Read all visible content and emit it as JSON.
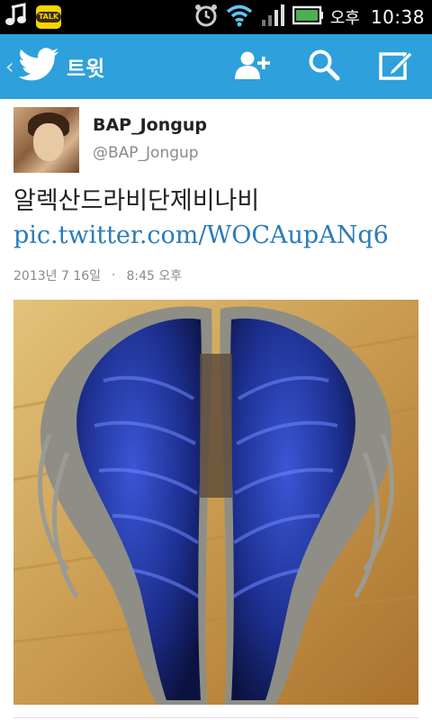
{
  "status_bar": {
    "ampm": "오후",
    "time": "10:38",
    "icons": [
      "music-note-icon",
      "kakaotalk-icon",
      "alarm-clock-icon",
      "wifi-icon",
      "signal-icon",
      "battery-icon"
    ],
    "talk_label": "TALK"
  },
  "header": {
    "title": "트윗",
    "accent_color": "#2ea0db",
    "actions": [
      "add-user-icon",
      "search-icon",
      "compose-icon"
    ]
  },
  "tweet": {
    "author_name": "BAP_Jongup",
    "author_handle": "@BAP_Jongup",
    "text": "알렉산드라비단제비나비 ",
    "link": "pic.twitter.com/WOCAupANq6",
    "date": "2013년 7 16일",
    "dot": "·",
    "time": "8:45 오후"
  }
}
